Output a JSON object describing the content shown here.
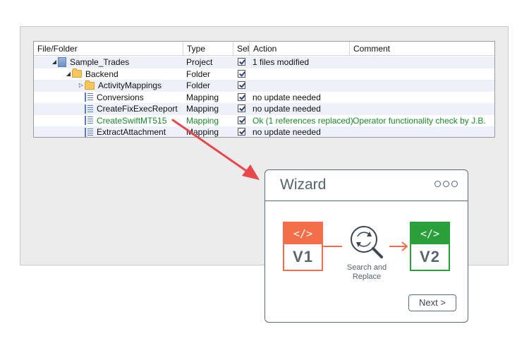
{
  "grid": {
    "columns": [
      "File/Folder",
      "Type",
      "Sel",
      "Action",
      "Comment"
    ],
    "rows": [
      {
        "name": "Sample_Trades",
        "type": "Project",
        "selected": true,
        "action": "1 files modified",
        "comment": "",
        "icon": "project-icon"
      },
      {
        "name": "Backend",
        "type": "Folder",
        "selected": true,
        "action": "",
        "comment": "",
        "icon": "folder-icon"
      },
      {
        "name": "ActivityMappings",
        "type": "Folder",
        "selected": true,
        "action": "",
        "comment": "",
        "icon": "folder-icon"
      },
      {
        "name": "Conversions",
        "type": "Mapping",
        "selected": true,
        "action": "no update needed",
        "comment": "",
        "icon": "mapping-icon"
      },
      {
        "name": "CreateFixExecReport",
        "type": "Mapping",
        "selected": true,
        "action": "no update needed",
        "comment": "",
        "icon": "mapping-icon"
      },
      {
        "name": "CreateSwiftMT515",
        "type": "Mapping",
        "selected": true,
        "action": "Ok (1 references replaced)",
        "comment": "Operator functionality check by J.B.",
        "icon": "mapping-icon",
        "highlight": "#198a2a"
      },
      {
        "name": "ExtractAttachment",
        "type": "Mapping",
        "selected": true,
        "action": "no update needed",
        "comment": "",
        "icon": "mapping-icon"
      }
    ]
  },
  "wizard": {
    "title": "Wizard",
    "v1_code": "</>",
    "v1_label": "V1",
    "v2_code": "</>",
    "v2_label": "V2",
    "search_label_line1": "Search and",
    "search_label_line2": "Replace",
    "next_label": "Next >"
  },
  "colors": {
    "arrow": "#e8474b",
    "v1": "#f26f4a",
    "v2": "#2aa03a",
    "wizard_border": "#5f6b77"
  }
}
